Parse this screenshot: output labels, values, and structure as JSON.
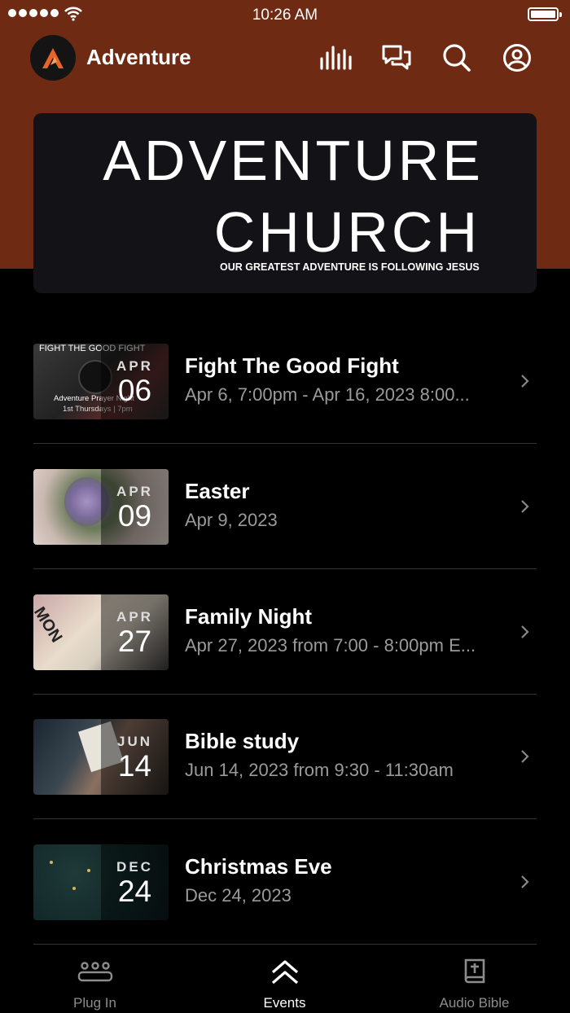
{
  "status_bar": {
    "time": "10:26 AM"
  },
  "header": {
    "app_name": "Adventure"
  },
  "banner": {
    "line1": "ADVENTURE",
    "line2": "CHURCH",
    "tagline": "OUR GREATEST ADVENTURE IS FOLLOWING JESUS"
  },
  "events": [
    {
      "title": "Fight The Good Fight",
      "month": "APR",
      "day": "06",
      "dates": "Apr 6, 7:00pm - Apr 16, 2023 8:00...",
      "thumb_caption_top": "FIGHT THE GOOD FIGHT",
      "thumb_caption_bottom": "Adventure Prayer Night",
      "thumb_caption_sub": "1st Thursdays | 7pm"
    },
    {
      "title": "Easter",
      "month": "APR",
      "day": "09",
      "dates": "Apr 9, 2023"
    },
    {
      "title": "Family Night",
      "month": "APR",
      "day": "27",
      "dates": "Apr 27, 2023 from 7:00 - 8:00pm E...",
      "thumb_text": "MON"
    },
    {
      "title": "Bible study",
      "month": "JUN",
      "day": "14",
      "dates": "Jun 14, 2023 from 9:30 - 11:30am"
    },
    {
      "title": "Christmas Eve",
      "month": "DEC",
      "day": "24",
      "dates": "Dec 24, 2023"
    }
  ],
  "tabs": [
    {
      "label": "Plug In",
      "icon": "people-group-icon"
    },
    {
      "label": "Events",
      "icon": "double-chevron-up-icon",
      "active": true
    },
    {
      "label": "Audio Bible",
      "icon": "bible-icon"
    }
  ],
  "colors": {
    "header_bg": "#6e2a12",
    "background": "#000000",
    "secondary_text": "#9a9a9a",
    "logo_accent": "#e8632a"
  }
}
